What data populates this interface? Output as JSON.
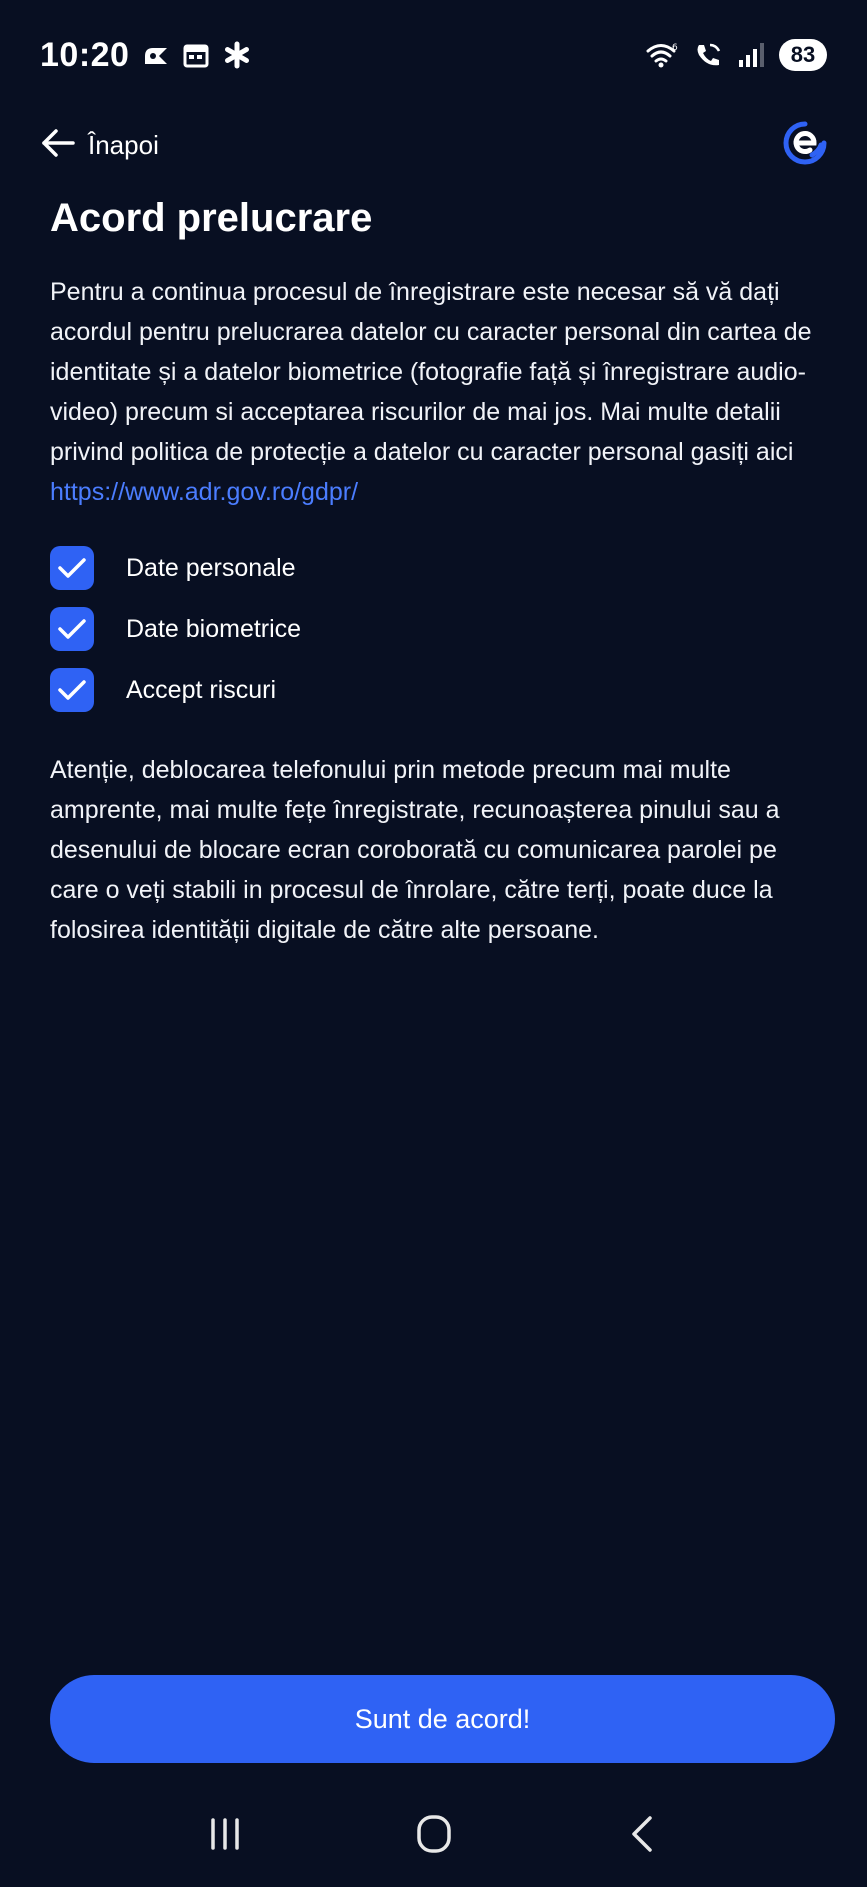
{
  "status_bar": {
    "time": "10:20",
    "battery": "83",
    "icons": [
      "notification-icon",
      "calendar-icon",
      "asterisk-icon",
      "wifi-icon",
      "wifi-call-icon",
      "signal-icon"
    ]
  },
  "nav": {
    "back_label": "Înapoi",
    "logo_icon": "app-logo-icon"
  },
  "page": {
    "title": "Acord prelucrare",
    "intro_text": "Pentru a continua procesul de înregistrare este necesar să vă dați acordul pentru prelucrarea datelor cu caracter personal din cartea de identitate și a datelor biometrice (fotografie față și înregistrare audio-video) precum si acceptarea riscurilor de mai jos. Mai multe detalii privind politica de protecție a datelor cu caracter personal gasiți aici ",
    "intro_link": "https://www.adr.gov.ro/gdpr/",
    "checkboxes": [
      {
        "label": "Date personale",
        "checked": true
      },
      {
        "label": "Date biometrice",
        "checked": true
      },
      {
        "label": "Accept riscuri",
        "checked": true
      }
    ],
    "warning_text": "Atenție, deblocarea telefonului prin metode precum mai multe amprente, mai multe fețe înregistrate, recunoașterea pinului sau a desenului de blocare ecran coroborată cu comunicarea parolei pe care o veți stabili in procesul de înrolare, către terți, poate duce la folosirea identității digitale de către alte persoane.",
    "primary_button": "Sunt de acord!"
  },
  "system_nav": [
    "recent-apps-icon",
    "home-icon",
    "back-icon"
  ],
  "colors": {
    "background": "#080f22",
    "accent": "#2f62f4",
    "link": "#4b7dff",
    "text": "#ffffff"
  }
}
